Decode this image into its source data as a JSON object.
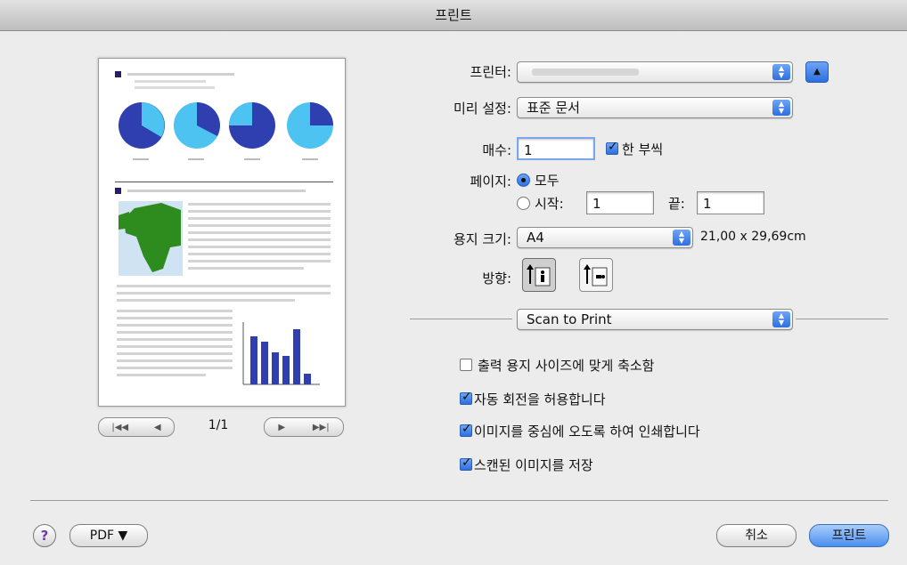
{
  "window": {
    "title": "프린트"
  },
  "preview": {
    "page_indicator": "1/1",
    "nav_first": "|◀◀",
    "nav_prev": "◀",
    "nav_next": "▶",
    "nav_last": "▶▶|"
  },
  "printer": {
    "label": "프린터:",
    "value": ""
  },
  "presets": {
    "label": "미리 설정:",
    "value": "표준 문서"
  },
  "copies": {
    "label": "매수:",
    "value": "1",
    "collated_label": "한 부씩",
    "collated": true
  },
  "pages": {
    "label": "페이지:",
    "all_label": "모두",
    "from_label": "시작:",
    "from_value": "1",
    "to_label": "끝:",
    "to_value": "1",
    "selected": "all"
  },
  "paper_size": {
    "label": "용지 크기:",
    "value": "A4",
    "dimensions": "21,00 x 29,69cm"
  },
  "orientation": {
    "label": "방향:",
    "selected": "portrait"
  },
  "panel": {
    "value": "Scan to Print"
  },
  "options": [
    {
      "label": "출력 용지 사이즈에 맞게 축소함",
      "checked": false
    },
    {
      "label": "자동 회전을 허용합니다",
      "checked": true
    },
    {
      "label": "이미지를 중심에 오도록 하여 인쇄합니다",
      "checked": true
    },
    {
      "label": "스캔된 이미지를 저장",
      "checked": true
    }
  ],
  "footer": {
    "help_label": "?",
    "pdf_label": "PDF ▼",
    "cancel_label": "취소",
    "print_label": "프린트"
  },
  "colors": {
    "accent": "#3b7be8",
    "chart_blue": "#2f3fb0",
    "pie_light": "#4cc3f0"
  }
}
